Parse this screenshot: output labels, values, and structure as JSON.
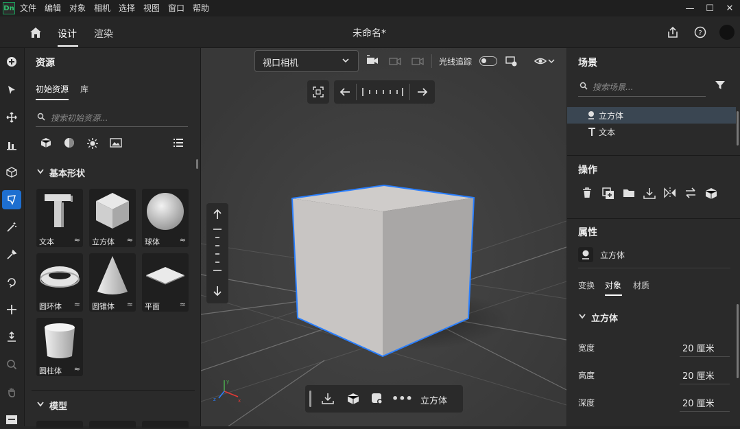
{
  "app": {
    "logo_text": "Dn",
    "document_title": "未命名*"
  },
  "menu": [
    "文件",
    "编辑",
    "对象",
    "相机",
    "选择",
    "视图",
    "窗口",
    "帮助"
  ],
  "window_controls": {
    "minimize": "—",
    "maximize": "☐",
    "close": "✕"
  },
  "header": {
    "tabs": [
      "设计",
      "渲染"
    ],
    "active_tab": "设计"
  },
  "assets": {
    "title": "资源",
    "tabs": [
      "初始资源",
      "库"
    ],
    "search_placeholder": "搜索初始资源...",
    "section_basic": "基本形状",
    "section_models": "模型",
    "shapes": [
      {
        "label": "文本"
      },
      {
        "label": "立方体"
      },
      {
        "label": "球体"
      },
      {
        "label": "圆环体"
      },
      {
        "label": "圆锥体"
      },
      {
        "label": "平面"
      },
      {
        "label": "圆柱体"
      }
    ]
  },
  "viewport": {
    "camera_select": "视口相机",
    "raytrace_label": "光线追踪",
    "raytrace_on": false,
    "bottom_selection": "立方体"
  },
  "scene": {
    "title": "场景",
    "search_placeholder": "搜索场景...",
    "items": [
      {
        "label": "立方体",
        "selected": true
      },
      {
        "label": "文本",
        "selected": false
      }
    ]
  },
  "actions": {
    "title": "操作"
  },
  "properties": {
    "title": "属性",
    "object_name": "立方体",
    "tabs": [
      "变换",
      "对象",
      "材质"
    ],
    "active_tab": "对象",
    "section": "立方体",
    "fields": [
      {
        "label": "宽度",
        "value": "20 厘米"
      },
      {
        "label": "高度",
        "value": "20 厘米"
      },
      {
        "label": "深度",
        "value": "20 厘米"
      }
    ]
  },
  "colors": {
    "accent": "#1e6fd0",
    "selection_outline": "#2a7fff",
    "logo": "#31c46f"
  }
}
